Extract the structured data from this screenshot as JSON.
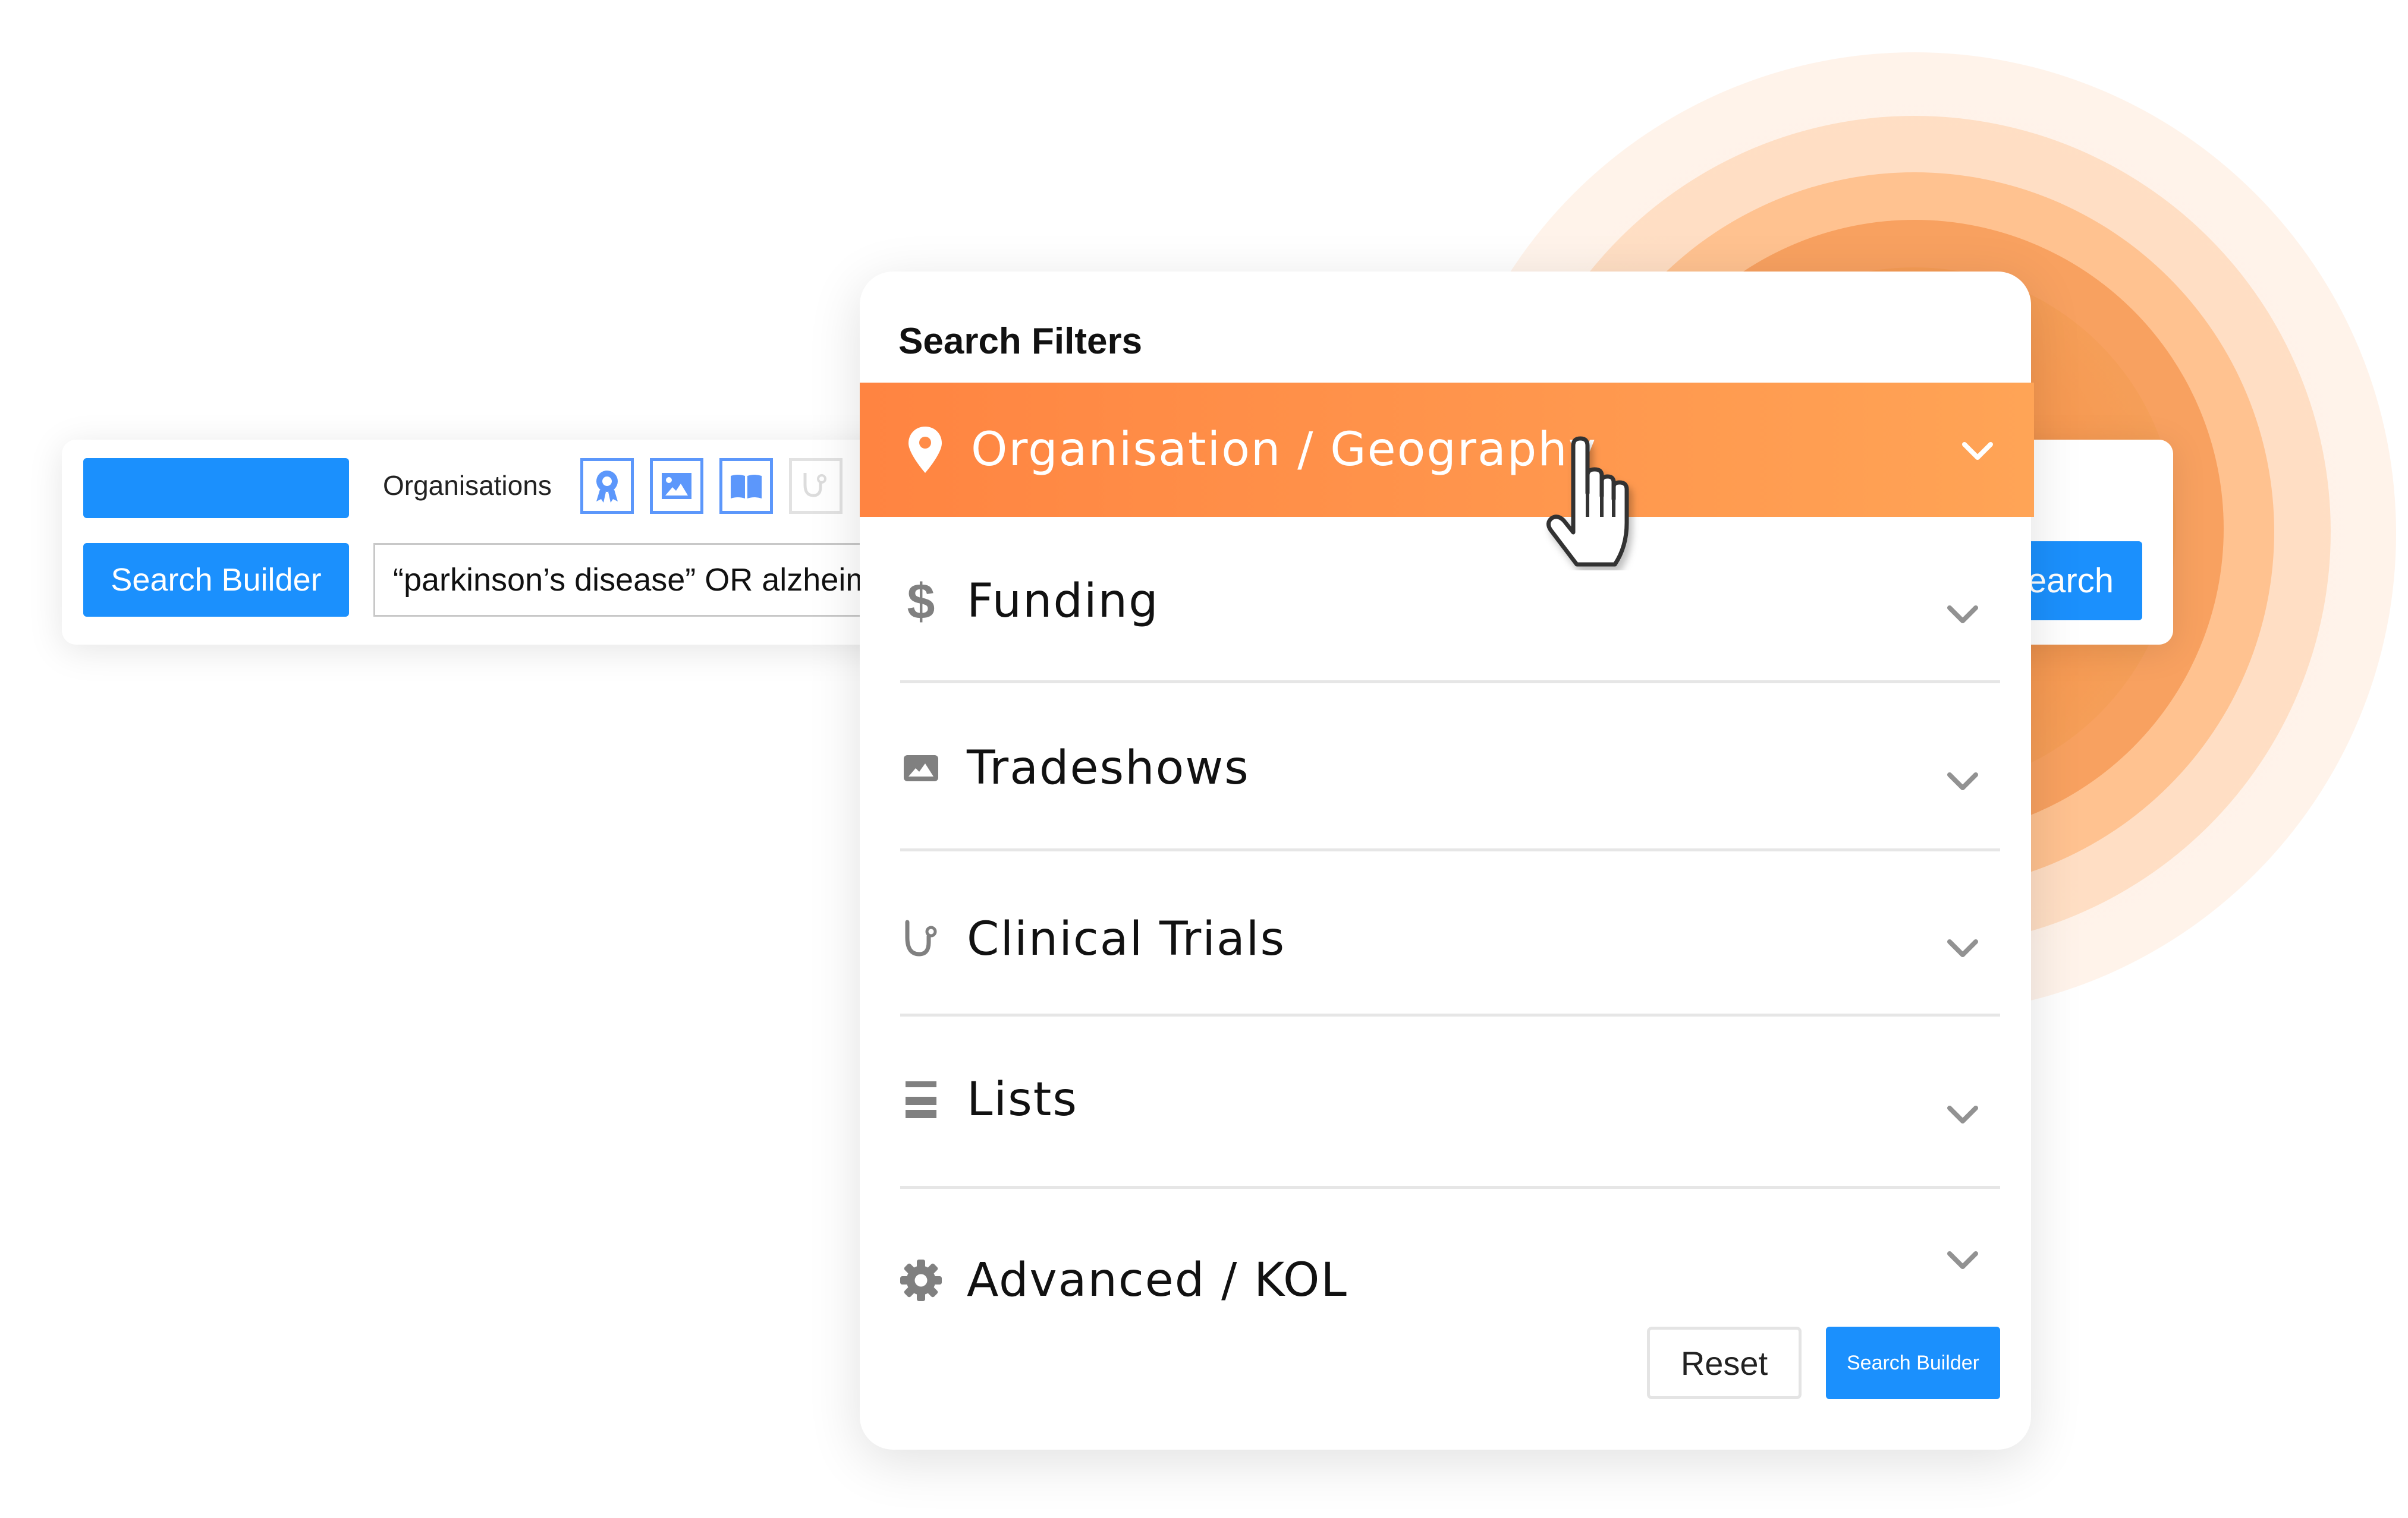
{
  "search_bar": {
    "top_button_label": "",
    "organisations_label": "Organisations",
    "filter_icons": [
      {
        "name": "award-icon",
        "enabled": true
      },
      {
        "name": "image-icon",
        "enabled": true
      },
      {
        "name": "book-icon",
        "enabled": true
      },
      {
        "name": "stethoscope-icon",
        "enabled": false
      }
    ],
    "search_builder_label": "Search Builder",
    "query_value": "“parkinson’s disease” OR alzheim",
    "search_label": "Search"
  },
  "filter_panel": {
    "title": "Search Filters",
    "items": [
      {
        "label": "Organisation / Geography",
        "icon": "map-pin-icon",
        "active": true
      },
      {
        "label": "Funding",
        "icon": "dollar-icon",
        "active": false
      },
      {
        "label": "Tradeshows",
        "icon": "image-icon",
        "active": false
      },
      {
        "label": "Clinical Trials",
        "icon": "stethoscope-icon",
        "active": false
      },
      {
        "label": "Lists",
        "icon": "list-icon",
        "active": false
      },
      {
        "label": "Advanced / KOL",
        "icon": "gear-icon",
        "active": false
      }
    ],
    "reset_label": "Reset",
    "search_builder_label": "Search Builder"
  },
  "colors": {
    "primary_blue": "#1b90fd",
    "icon_blue": "#5c97fb",
    "accent_orange_start": "#ff8441",
    "accent_orange_end": "#ffa456",
    "icon_gray": "#808080"
  }
}
